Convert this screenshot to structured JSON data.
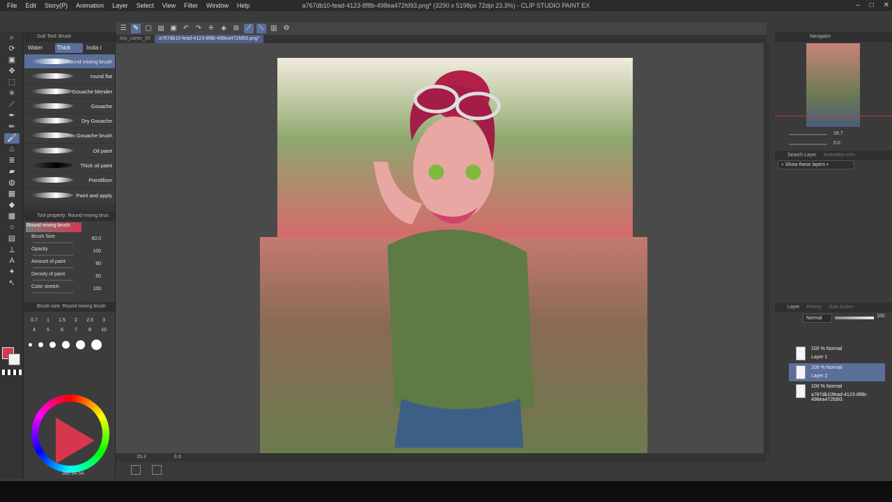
{
  "menu": [
    "File",
    "Edit",
    "Story(P)",
    "Animation",
    "Layer",
    "Select",
    "View",
    "Filter",
    "Window",
    "Help"
  ],
  "window_title": "a767db10-fead-4123-8f8b-498ea472fd93.png* (3290 x 5198px 72dpi 23.3%) - CLIP STUDIO PAINT EX",
  "subtool": {
    "header": "Sub Tool: Brush",
    "tabs": [
      "Water",
      "Thick",
      "India i"
    ],
    "brushes": [
      {
        "label": "Round mixing brush",
        "dark": false
      },
      {
        "label": "round flat",
        "dark": false
      },
      {
        "label": "Gouache blender",
        "dark": false
      },
      {
        "label": "Gouache",
        "dark": false
      },
      {
        "label": "Dry Gouache",
        "dark": false
      },
      {
        "label": "Thin Gouache brush",
        "dark": false
      },
      {
        "label": "Oil paint",
        "dark": false
      },
      {
        "label": "Thick oil paint",
        "dark": true
      },
      {
        "label": "Pointillism",
        "dark": false
      },
      {
        "label": "Paint and apply",
        "dark": false
      }
    ]
  },
  "tool_property": {
    "header": "Tool property: Round mixing brus",
    "preview_label": "Round mixing brush",
    "rows": [
      {
        "label": "Brush Size",
        "value": "60.0"
      },
      {
        "label": "Opacity",
        "value": "100"
      },
      {
        "label": "Amount of paint",
        "value": "80"
      },
      {
        "label": "Density of paint",
        "value": "50"
      },
      {
        "label": "Color stretch",
        "value": "100"
      }
    ]
  },
  "brush_size": {
    "header": "Brush size: Round mixing brush",
    "values": [
      "0.7",
      "1",
      "1.5",
      "2",
      "2.5",
      "3",
      "4",
      "5",
      "6",
      "7",
      "8",
      "10"
    ]
  },
  "color": {
    "hsv": [
      "360",
      "54",
      "54"
    ],
    "main": "#d4394f",
    "sub": "#f2f2f2"
  },
  "doc_tabs": [
    "lois_carter_65",
    "a767db10-fead-4123-8f8b-498ea472fd93.png*"
  ],
  "status": {
    "zoom": "25.3",
    "angle": "0.0"
  },
  "navigator": {
    "title": "Navigator",
    "zoom": "16.7",
    "rotate": "0.0"
  },
  "search_layer": {
    "tab": "Search Layer",
    "tab2": "Animation cels",
    "dropdown": "Show these layers"
  },
  "layer_panel": {
    "tabs": [
      "Layer",
      "History",
      "Auto Action"
    ],
    "blend": "Normal",
    "opacity": "100",
    "layers": [
      {
        "mode": "100 % Normal",
        "name": "Layer 1",
        "selected": false
      },
      {
        "mode": "100 % Normal",
        "name": "Layer 2",
        "selected": true
      },
      {
        "mode": "100 % Normal",
        "name": "a767db10fead-4123-8f8b-498ea472fd93",
        "selected": false
      }
    ]
  }
}
